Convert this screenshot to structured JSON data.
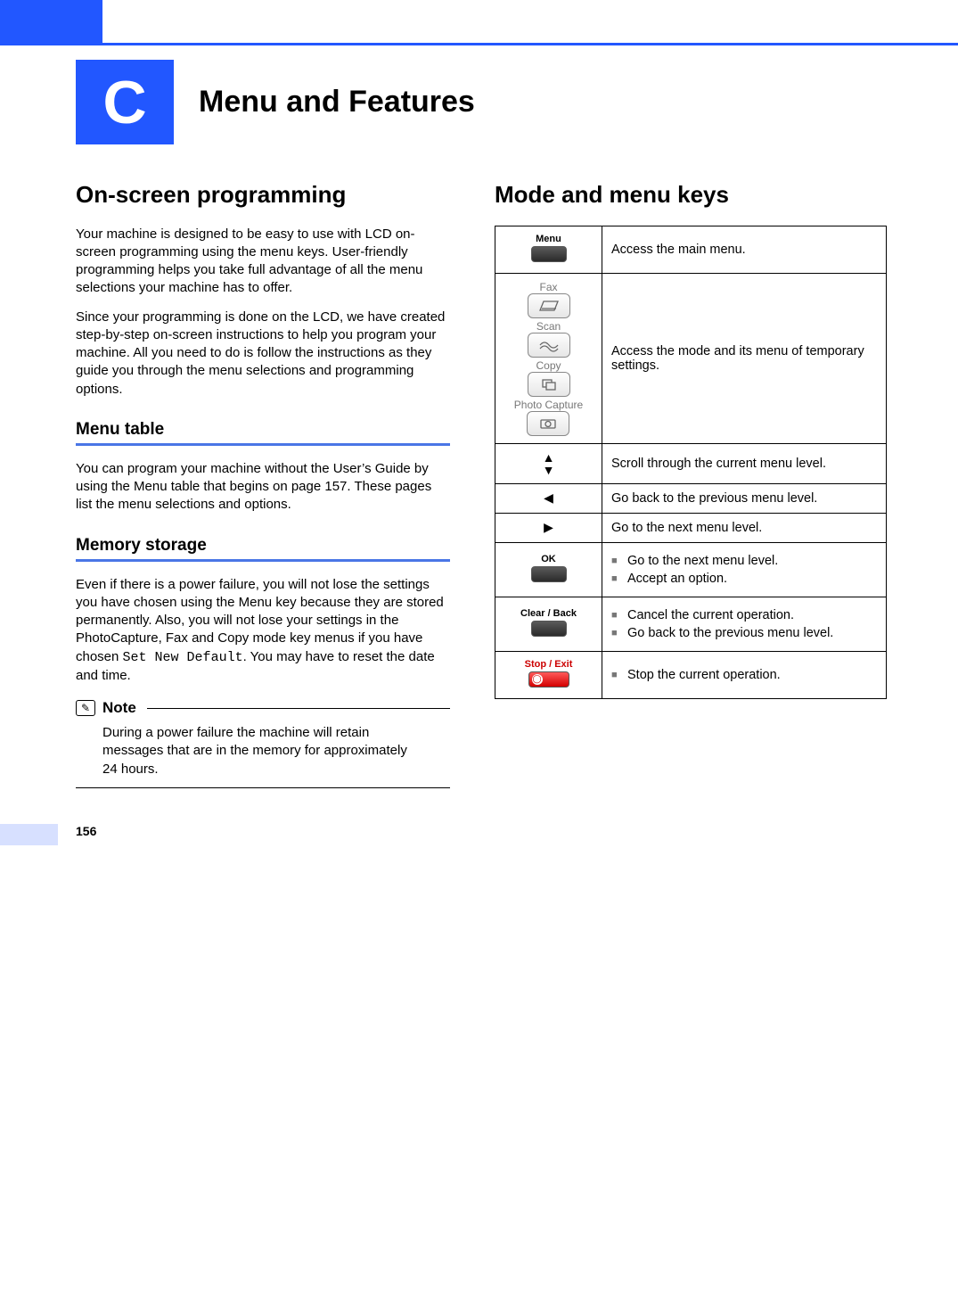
{
  "page_number": "156",
  "header": {
    "letter": "C",
    "title": "Menu and Features"
  },
  "left": {
    "h1": "On-screen programming",
    "p1": "Your machine is designed to be easy to use with LCD on-screen programming using the menu keys. User-friendly programming helps you take full advantage of all the menu selections your machine has to offer.",
    "p2": "Since your programming is done on the LCD, we have created step-by-step on-screen instructions to help you program your machine. All you need to do is follow the instructions as they guide you through the menu selections and programming options.",
    "menu_table": {
      "heading": "Menu table",
      "text": "You can program your machine without the User’s Guide by using the Menu table that begins on page 157. These pages list the menu selections and options."
    },
    "memory": {
      "heading": "Memory storage",
      "text_pre": "Even if there is a power failure, you will not lose the settings you have chosen using the Menu key because they are stored permanently. Also, you will not lose your settings in the PhotoCapture, Fax and Copy mode key menus if you have chosen ",
      "mono": "Set New Default",
      "text_post": ". You may have to reset the date and time."
    },
    "note": {
      "label": "Note",
      "text": "During a power failure the machine will retain messages that are in the memory for approximately 24 hours."
    }
  },
  "right": {
    "h1": "Mode and menu keys",
    "rows": [
      {
        "key_label": "Menu",
        "key_style": "menu",
        "desc": "Access the main menu."
      },
      {
        "key_label": "",
        "key_style": "modes",
        "desc": "Access the mode and its menu of temporary settings.",
        "modes": [
          "Fax",
          "Scan",
          "Copy",
          "Photo Capture"
        ]
      },
      {
        "key_label": "",
        "key_style": "arrows-ud",
        "desc": "Scroll through the current menu level."
      },
      {
        "key_label": "",
        "key_style": "arrow-left",
        "desc": "Go back to the previous menu level."
      },
      {
        "key_label": "",
        "key_style": "arrow-right",
        "desc": "Go to the next menu level."
      },
      {
        "key_label": "OK",
        "key_style": "ok",
        "list": [
          "Go to the next menu level.",
          "Accept an option."
        ]
      },
      {
        "key_label": "Clear / Back",
        "key_style": "clear",
        "list": [
          "Cancel the current operation.",
          "Go back to the previous menu level."
        ]
      },
      {
        "key_label": "Stop / Exit",
        "key_style": "stop",
        "list": [
          "Stop the current operation."
        ]
      }
    ]
  }
}
